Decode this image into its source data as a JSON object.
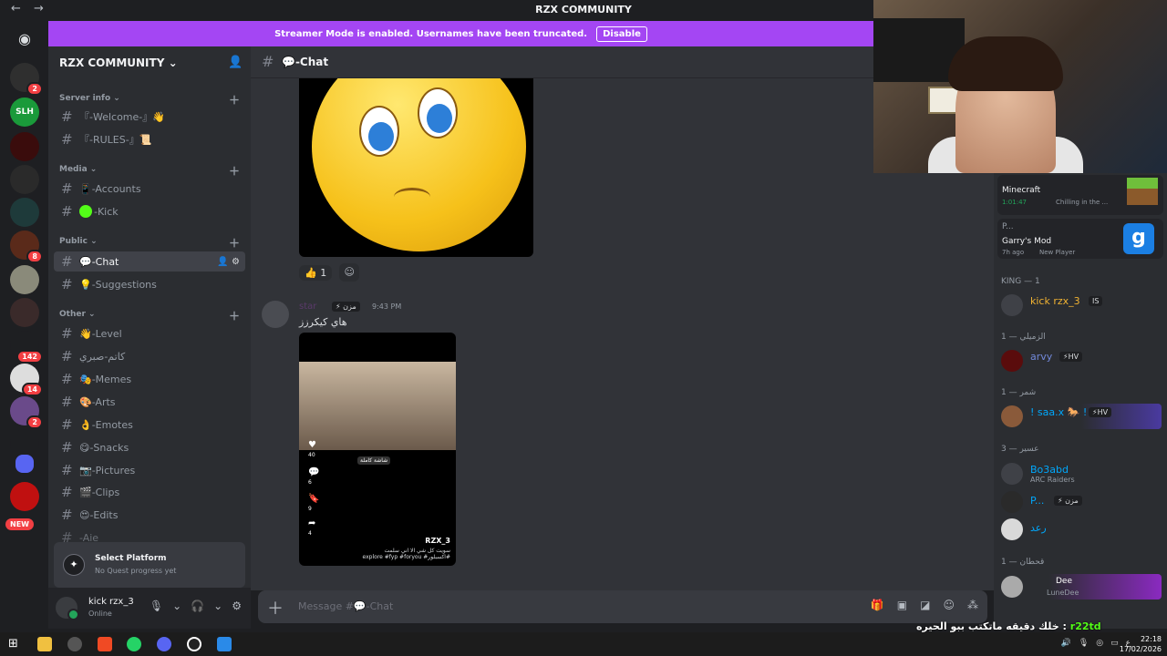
{
  "window": {
    "title": "RZX COMMUNITY",
    "back": "←",
    "forward": "→"
  },
  "banner": {
    "text": "Streamer Mode is enabled. Usernames have been truncated.",
    "button": "Disable"
  },
  "guilds": [
    {
      "name": "discord-home"
    },
    {
      "name": "server-1",
      "badge": "2"
    },
    {
      "name": "server-slh",
      "label": "SLH"
    },
    {
      "name": "server-3"
    },
    {
      "name": "server-4"
    },
    {
      "name": "server-5"
    },
    {
      "name": "server-6",
      "badge": "8"
    },
    {
      "name": "server-7"
    },
    {
      "name": "server-8"
    },
    {
      "name": "server-9",
      "badge": "142"
    },
    {
      "name": "server-10",
      "badge": "14"
    },
    {
      "name": "server-11",
      "badge": "2"
    },
    {
      "name": "server-12"
    },
    {
      "name": "server-13"
    },
    {
      "name": "server-14"
    }
  ],
  "new_label": "NEW",
  "sidebar": {
    "server_name": "RZX COMMUNITY",
    "categories": [
      {
        "name": "Server info",
        "channels": [
          "『-Welcome-』👋",
          "『-RULES-』📜"
        ]
      },
      {
        "name": "Media",
        "channels": [
          "📱-Accounts",
          "-Kick"
        ]
      },
      {
        "name": "Public",
        "channels": [
          "💬-Chat",
          "💡-Suggestions"
        ]
      },
      {
        "name": "Other",
        "channels": [
          "👋-Level",
          "كاتم-صبري",
          "🎭-Memes",
          "🎨-Arts",
          "👌-Emotes",
          "😋-Snacks",
          "📷-Pictures",
          "🎬-Clips",
          "😍-Edits",
          "-Aie"
        ]
      }
    ]
  },
  "quest": {
    "title": "Select Platform",
    "subtitle": "No Quest progress yet"
  },
  "user": {
    "name": "kick rzx_3",
    "status": "Online"
  },
  "header": {
    "channel": "💬-Chat"
  },
  "message1": {
    "reaction_emoji": "👍",
    "reaction_count": "1"
  },
  "message2": {
    "author": "star",
    "tag": "⚡ مزن",
    "time": "9:43 PM",
    "text": "هاي كيكرزز",
    "video": {
      "username": "RZX_3",
      "fullscreen": "شاشة كاملة",
      "caption": "سويت كل شي الا اني سلمت",
      "hashtags": "explore #fyp #foryou #اكسبلور#",
      "likes": "40",
      "comments": "6",
      "saves": "9",
      "shares": "4"
    }
  },
  "composer": {
    "placeholder": "Message #💬-Chat"
  },
  "activities": [
    {
      "game": "Minecraft",
      "elapsed": "1:01:47",
      "detail": "Chilling in the ..."
    },
    {
      "user": "P...",
      "game": "Garry's Mod",
      "elapsed": "7h ago",
      "detail": "New Player"
    }
  ],
  "member_groups": [
    {
      "role": "KING — 1",
      "members": [
        {
          "name": "kick rzx_3",
          "tag": "IS",
          "color": "#f0b232"
        }
      ]
    },
    {
      "role": "الزميلي — 1",
      "members": [
        {
          "name": "arvy",
          "tag": "⚡HV",
          "color": "#5865f2"
        }
      ]
    },
    {
      "role": "شمر — 1",
      "members": [
        {
          "name": "! saa.x 🐎 !",
          "tag": "⚡HV",
          "color": "#5865f2"
        }
      ]
    },
    {
      "role": "عسير — 3",
      "members": [
        {
          "name": "Bo3abd",
          "sub": "ARC Raiders",
          "color": "#00a8fc"
        },
        {
          "name": "P...",
          "tag": "⚡ مزن",
          "color": "#00a8fc"
        },
        {
          "name": "رعد",
          "color": "#00a8fc"
        }
      ]
    },
    {
      "role": "قحطان — 1",
      "members": [
        {
          "name": "Dee",
          "sub": "LuneDee",
          "color": "#ed4245"
        }
      ]
    }
  ],
  "overlay": {
    "user": "r22td",
    "text": "خلك دقيقه ماتكتب ببو الحيره :"
  },
  "taskbar": {
    "time": "22:18",
    "date": "17/02/2026",
    "lang": "ع"
  }
}
